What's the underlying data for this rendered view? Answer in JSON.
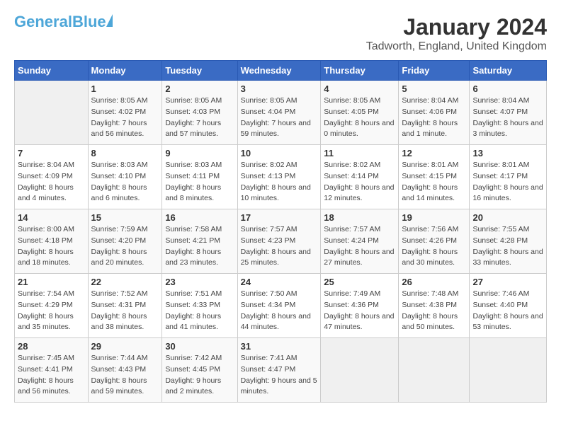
{
  "header": {
    "logo_general": "General",
    "logo_blue": "Blue",
    "main_title": "January 2024",
    "subtitle": "Tadworth, England, United Kingdom"
  },
  "calendar": {
    "weekdays": [
      "Sunday",
      "Monday",
      "Tuesday",
      "Wednesday",
      "Thursday",
      "Friday",
      "Saturday"
    ],
    "weeks": [
      [
        {
          "day": "",
          "sunrise": "",
          "sunset": "",
          "daylight": ""
        },
        {
          "day": "1",
          "sunrise": "Sunrise: 8:05 AM",
          "sunset": "Sunset: 4:02 PM",
          "daylight": "Daylight: 7 hours and 56 minutes."
        },
        {
          "day": "2",
          "sunrise": "Sunrise: 8:05 AM",
          "sunset": "Sunset: 4:03 PM",
          "daylight": "Daylight: 7 hours and 57 minutes."
        },
        {
          "day": "3",
          "sunrise": "Sunrise: 8:05 AM",
          "sunset": "Sunset: 4:04 PM",
          "daylight": "Daylight: 7 hours and 59 minutes."
        },
        {
          "day": "4",
          "sunrise": "Sunrise: 8:05 AM",
          "sunset": "Sunset: 4:05 PM",
          "daylight": "Daylight: 8 hours and 0 minutes."
        },
        {
          "day": "5",
          "sunrise": "Sunrise: 8:04 AM",
          "sunset": "Sunset: 4:06 PM",
          "daylight": "Daylight: 8 hours and 1 minute."
        },
        {
          "day": "6",
          "sunrise": "Sunrise: 8:04 AM",
          "sunset": "Sunset: 4:07 PM",
          "daylight": "Daylight: 8 hours and 3 minutes."
        }
      ],
      [
        {
          "day": "7",
          "sunrise": "Sunrise: 8:04 AM",
          "sunset": "Sunset: 4:09 PM",
          "daylight": "Daylight: 8 hours and 4 minutes."
        },
        {
          "day": "8",
          "sunrise": "Sunrise: 8:03 AM",
          "sunset": "Sunset: 4:10 PM",
          "daylight": "Daylight: 8 hours and 6 minutes."
        },
        {
          "day": "9",
          "sunrise": "Sunrise: 8:03 AM",
          "sunset": "Sunset: 4:11 PM",
          "daylight": "Daylight: 8 hours and 8 minutes."
        },
        {
          "day": "10",
          "sunrise": "Sunrise: 8:02 AM",
          "sunset": "Sunset: 4:13 PM",
          "daylight": "Daylight: 8 hours and 10 minutes."
        },
        {
          "day": "11",
          "sunrise": "Sunrise: 8:02 AM",
          "sunset": "Sunset: 4:14 PM",
          "daylight": "Daylight: 8 hours and 12 minutes."
        },
        {
          "day": "12",
          "sunrise": "Sunrise: 8:01 AM",
          "sunset": "Sunset: 4:15 PM",
          "daylight": "Daylight: 8 hours and 14 minutes."
        },
        {
          "day": "13",
          "sunrise": "Sunrise: 8:01 AM",
          "sunset": "Sunset: 4:17 PM",
          "daylight": "Daylight: 8 hours and 16 minutes."
        }
      ],
      [
        {
          "day": "14",
          "sunrise": "Sunrise: 8:00 AM",
          "sunset": "Sunset: 4:18 PM",
          "daylight": "Daylight: 8 hours and 18 minutes."
        },
        {
          "day": "15",
          "sunrise": "Sunrise: 7:59 AM",
          "sunset": "Sunset: 4:20 PM",
          "daylight": "Daylight: 8 hours and 20 minutes."
        },
        {
          "day": "16",
          "sunrise": "Sunrise: 7:58 AM",
          "sunset": "Sunset: 4:21 PM",
          "daylight": "Daylight: 8 hours and 23 minutes."
        },
        {
          "day": "17",
          "sunrise": "Sunrise: 7:57 AM",
          "sunset": "Sunset: 4:23 PM",
          "daylight": "Daylight: 8 hours and 25 minutes."
        },
        {
          "day": "18",
          "sunrise": "Sunrise: 7:57 AM",
          "sunset": "Sunset: 4:24 PM",
          "daylight": "Daylight: 8 hours and 27 minutes."
        },
        {
          "day": "19",
          "sunrise": "Sunrise: 7:56 AM",
          "sunset": "Sunset: 4:26 PM",
          "daylight": "Daylight: 8 hours and 30 minutes."
        },
        {
          "day": "20",
          "sunrise": "Sunrise: 7:55 AM",
          "sunset": "Sunset: 4:28 PM",
          "daylight": "Daylight: 8 hours and 33 minutes."
        }
      ],
      [
        {
          "day": "21",
          "sunrise": "Sunrise: 7:54 AM",
          "sunset": "Sunset: 4:29 PM",
          "daylight": "Daylight: 8 hours and 35 minutes."
        },
        {
          "day": "22",
          "sunrise": "Sunrise: 7:52 AM",
          "sunset": "Sunset: 4:31 PM",
          "daylight": "Daylight: 8 hours and 38 minutes."
        },
        {
          "day": "23",
          "sunrise": "Sunrise: 7:51 AM",
          "sunset": "Sunset: 4:33 PM",
          "daylight": "Daylight: 8 hours and 41 minutes."
        },
        {
          "day": "24",
          "sunrise": "Sunrise: 7:50 AM",
          "sunset": "Sunset: 4:34 PM",
          "daylight": "Daylight: 8 hours and 44 minutes."
        },
        {
          "day": "25",
          "sunrise": "Sunrise: 7:49 AM",
          "sunset": "Sunset: 4:36 PM",
          "daylight": "Daylight: 8 hours and 47 minutes."
        },
        {
          "day": "26",
          "sunrise": "Sunrise: 7:48 AM",
          "sunset": "Sunset: 4:38 PM",
          "daylight": "Daylight: 8 hours and 50 minutes."
        },
        {
          "day": "27",
          "sunrise": "Sunrise: 7:46 AM",
          "sunset": "Sunset: 4:40 PM",
          "daylight": "Daylight: 8 hours and 53 minutes."
        }
      ],
      [
        {
          "day": "28",
          "sunrise": "Sunrise: 7:45 AM",
          "sunset": "Sunset: 4:41 PM",
          "daylight": "Daylight: 8 hours and 56 minutes."
        },
        {
          "day": "29",
          "sunrise": "Sunrise: 7:44 AM",
          "sunset": "Sunset: 4:43 PM",
          "daylight": "Daylight: 8 hours and 59 minutes."
        },
        {
          "day": "30",
          "sunrise": "Sunrise: 7:42 AM",
          "sunset": "Sunset: 4:45 PM",
          "daylight": "Daylight: 9 hours and 2 minutes."
        },
        {
          "day": "31",
          "sunrise": "Sunrise: 7:41 AM",
          "sunset": "Sunset: 4:47 PM",
          "daylight": "Daylight: 9 hours and 5 minutes."
        },
        {
          "day": "",
          "sunrise": "",
          "sunset": "",
          "daylight": ""
        },
        {
          "day": "",
          "sunrise": "",
          "sunset": "",
          "daylight": ""
        },
        {
          "day": "",
          "sunrise": "",
          "sunset": "",
          "daylight": ""
        }
      ]
    ]
  }
}
